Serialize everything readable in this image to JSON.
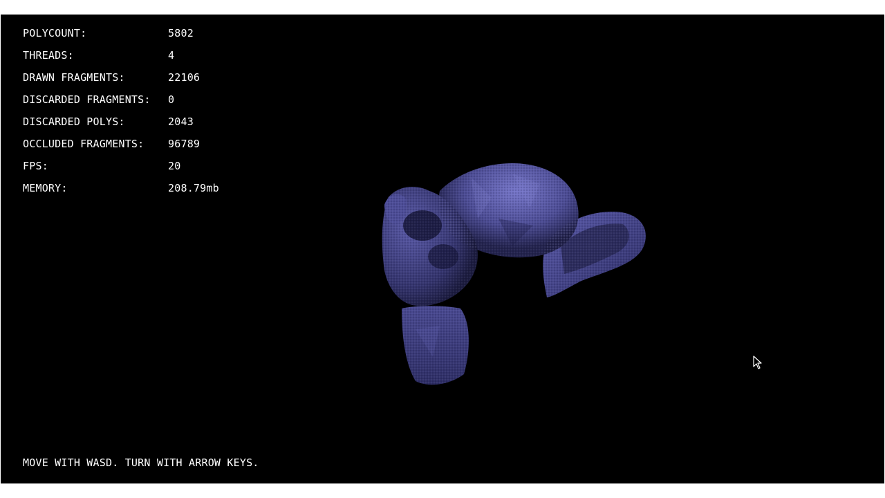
{
  "stats": [
    {
      "label": "POLYCOUNT:",
      "value": "5802"
    },
    {
      "label": "THREADS:",
      "value": "4"
    },
    {
      "label": "DRAWN FRAGMENTS:",
      "value": "22106"
    },
    {
      "label": "DISCARDED FRAGMENTS:",
      "value": "0"
    },
    {
      "label": "DISCARDED POLYS:",
      "value": "2043"
    },
    {
      "label": "OCCLUDED FRAGMENTS:",
      "value": "96789"
    },
    {
      "label": "FPS:",
      "value": "20"
    },
    {
      "label": "MEMORY:",
      "value": "208.79mb"
    }
  ],
  "instructions": "MOVE WITH WASD. TURN WITH ARROW KEYS.",
  "colors": {
    "background": "#000000",
    "text": "#ffffff",
    "model_light": "#6f6fc4",
    "model_dark": "#2a2a5c"
  },
  "icons": {
    "model": "rendered-monkey-head-model",
    "cursor": "mouse-pointer-icon"
  }
}
